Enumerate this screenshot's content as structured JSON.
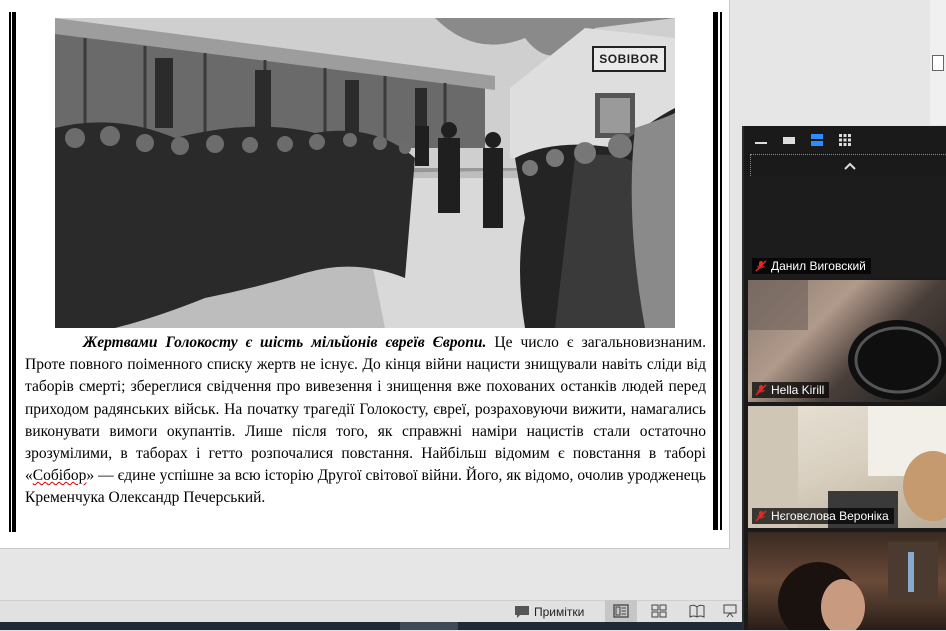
{
  "slide": {
    "sign_text": "SOBIBOR",
    "paragraph": {
      "bold_lead": "Жертвами Голокосту є шість мільйонів євреїв Європи.",
      "body_part1": " Це число є загальновизнаним. Проте повного поіменного списку жертв не існує. До кінця війни нацисти знищували навіть сліди від таборів смерті; збереглися свідчення про вивезення і знищення вже похованих останків людей перед приходом радянських військ.  На початку трагедії Голокосту, євреї, розраховуючи вижити, намагались виконувати вимоги окупантів. Лише після того, як справжні наміри нацистів стали остаточно зрозумілими, в таборах і гетто розпочалися повстання.  Найбільш відомим є повстання в таборі «",
      "underlined_word": "Собібор",
      "body_part2": "» — єдине успішне за всю історію Другої світової війни. Його, як відомо, очолив уродженець Кременчука Олександр Печерський."
    }
  },
  "statusbar": {
    "notes_label": "Примітки",
    "notes_icon": "notes-icon",
    "view_buttons": [
      "normal-view-icon",
      "slide-sorter-icon",
      "reading-view-icon",
      "slideshow-icon"
    ]
  },
  "zoom_panel": {
    "toolbar_icons": [
      "minimize-icon",
      "thumbnail-view-icon",
      "speaker-view-icon",
      "gallery-view-icon"
    ],
    "participants": [
      {
        "name": "Данил Виговский",
        "muted": true
      },
      {
        "name": "Hella Kirill",
        "muted": true
      },
      {
        "name": "Нєговєлова Вероніка",
        "muted": true
      },
      {
        "name": "",
        "muted": false
      }
    ],
    "colors": {
      "panel_bg": "#1a1a1a",
      "muted_icon": "#e02b2b",
      "accent": "#2d8cff"
    }
  }
}
